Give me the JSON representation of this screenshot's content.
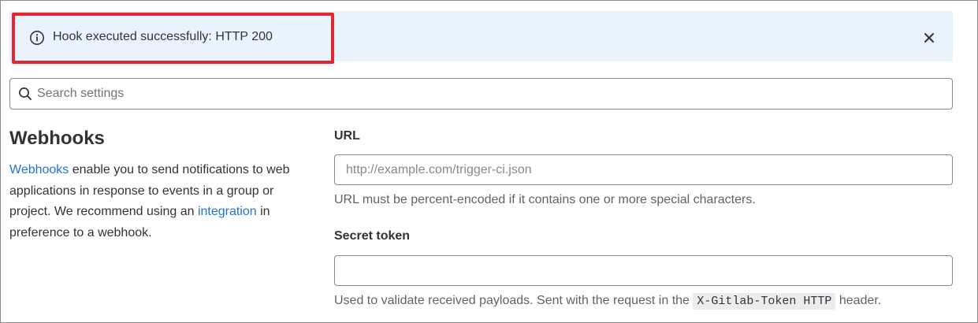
{
  "alert": {
    "message": "Hook executed successfully: HTTP 200",
    "icon": "info-circle-icon",
    "close_icon": "close-icon",
    "background": "#e9f3fc",
    "highlight_color": "#e3262f"
  },
  "search": {
    "placeholder": "Search settings",
    "value": ""
  },
  "section": {
    "title": "Webhooks",
    "desc_link1": "Webhooks",
    "desc_text1": " enable you to send notifications to web applications in response to events in a group or project. We recommend using an ",
    "desc_link2": "integration",
    "desc_text2": " in preference to a webhook."
  },
  "form": {
    "url_label": "URL",
    "url_placeholder": "http://example.com/trigger-ci.json",
    "url_value": "",
    "url_help": "URL must be percent-encoded if it contains one or more special characters.",
    "token_label": "Secret token",
    "token_value": "",
    "token_help_before": "Used to validate received payloads. Sent with the request in the ",
    "token_help_code": "X-Gitlab-Token HTTP",
    "token_help_after": " header."
  },
  "colors": {
    "link": "#1f75cb",
    "text": "#333238",
    "muted": "#626168"
  }
}
